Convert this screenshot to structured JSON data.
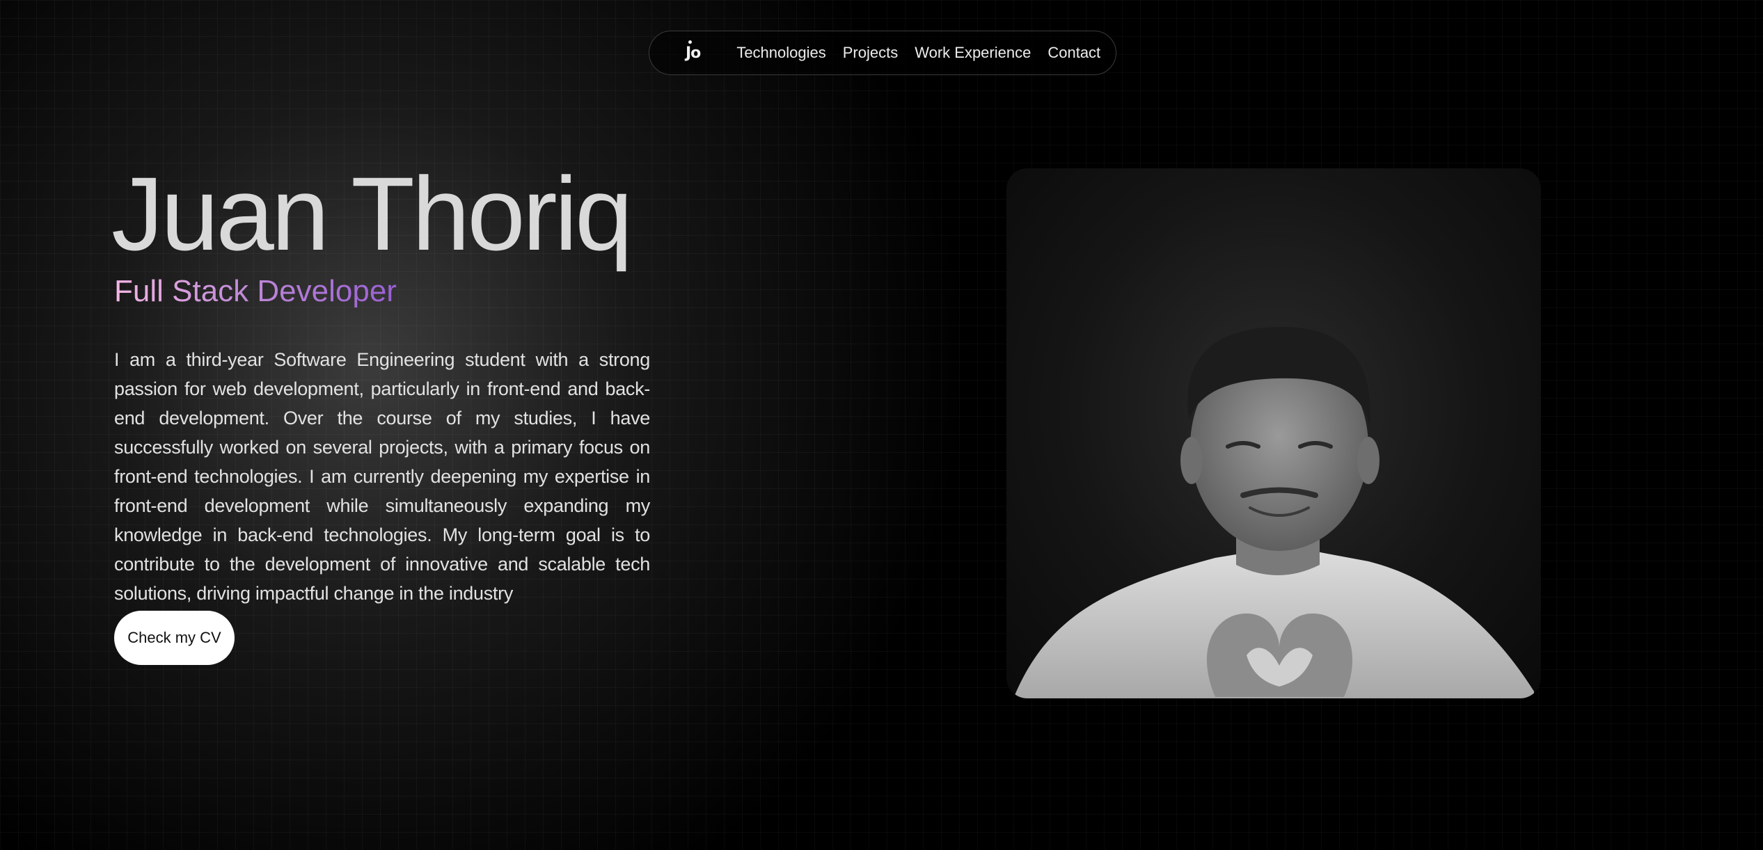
{
  "nav": {
    "logo": "Jo",
    "links": [
      "Technologies",
      "Projects",
      "Work Experience",
      "Contact"
    ]
  },
  "hero": {
    "name": "Juan Thoriq",
    "role": "Full Stack Developer",
    "bio": "I am a third-year Software Engineering student with a strong passion for web development, particularly in front-end and back-end development. Over the course of my studies, I have successfully worked on several projects, with a primary focus on front-end technologies. I am currently deepening my expertise in front-end development while simultaneously expanding my knowledge in back-end technologies. My long-term goal is to contribute to the development of innovative and scalable tech solutions, driving impactful change in the industry",
    "cv_button": "Check my CV"
  },
  "colors": {
    "background": "#000000",
    "role_gradient_start": "#f4b6e6",
    "role_gradient_end": "#9a5fd6",
    "button_bg": "#ffffff"
  }
}
